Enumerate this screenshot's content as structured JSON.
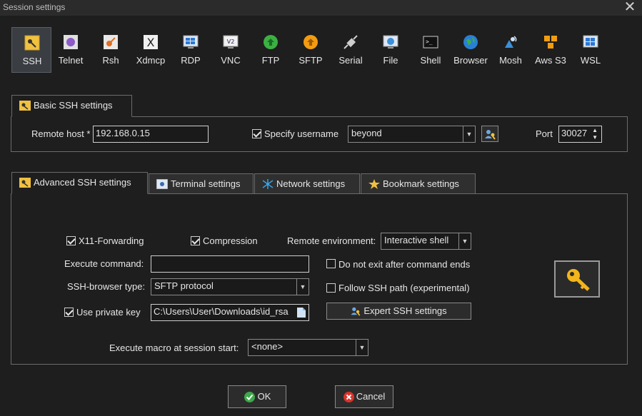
{
  "window": {
    "title": "Session settings",
    "close_glyph": "✕"
  },
  "protocols": [
    {
      "label": "SSH",
      "icon": "ssh-icon"
    },
    {
      "label": "Telnet",
      "icon": "telnet-icon"
    },
    {
      "label": "Rsh",
      "icon": "rsh-icon"
    },
    {
      "label": "Xdmcp",
      "icon": "xdmcp-icon"
    },
    {
      "label": "RDP",
      "icon": "rdp-icon"
    },
    {
      "label": "VNC",
      "icon": "vnc-icon"
    },
    {
      "label": "FTP",
      "icon": "ftp-icon"
    },
    {
      "label": "SFTP",
      "icon": "sftp-icon"
    },
    {
      "label": "Serial",
      "icon": "serial-icon"
    },
    {
      "label": "File",
      "icon": "file-icon"
    },
    {
      "label": "Shell",
      "icon": "shell-icon"
    },
    {
      "label": "Browser",
      "icon": "browser-icon"
    },
    {
      "label": "Mosh",
      "icon": "mosh-icon"
    },
    {
      "label": "Aws S3",
      "icon": "aws-s3-icon"
    },
    {
      "label": "WSL",
      "icon": "wsl-icon"
    }
  ],
  "basic": {
    "tab_label": "Basic SSH settings",
    "remote_host_label": "Remote host *",
    "remote_host_value": "192.168.0.15",
    "specify_username_label": "Specify username",
    "specify_username_checked": true,
    "username_value": "beyond",
    "port_label": "Port",
    "port_value": "30027"
  },
  "tabs": [
    {
      "label": "Advanced SSH settings",
      "active": true
    },
    {
      "label": "Terminal settings",
      "active": false
    },
    {
      "label": "Network settings",
      "active": false
    },
    {
      "label": "Bookmark settings",
      "active": false
    }
  ],
  "advanced": {
    "x11_label": "X11-Forwarding",
    "x11_checked": true,
    "compression_label": "Compression",
    "compression_checked": true,
    "remote_env_label": "Remote environment:",
    "remote_env_value": "Interactive shell",
    "execute_command_label": "Execute command:",
    "execute_command_value": "",
    "no_exit_label": "Do not exit after command ends",
    "no_exit_checked": false,
    "browser_type_label": "SSH-browser type:",
    "browser_type_value": "SFTP protocol",
    "follow_path_label": "Follow SSH path (experimental)",
    "follow_path_checked": false,
    "private_key_label": "Use private key",
    "private_key_checked": true,
    "private_key_value": "C:\\Users\\User\\Downloads\\id_rsa",
    "expert_button_label": "Expert SSH settings",
    "macro_label": "Execute macro at session start:",
    "macro_value": "<none>"
  },
  "footer": {
    "ok_label": "OK",
    "cancel_label": "Cancel"
  },
  "colors": {
    "accent_selected": "#3a3d42",
    "ok_green": "#3ea84a",
    "cancel_red": "#d9342b",
    "key_gold": "#f2b51c"
  }
}
